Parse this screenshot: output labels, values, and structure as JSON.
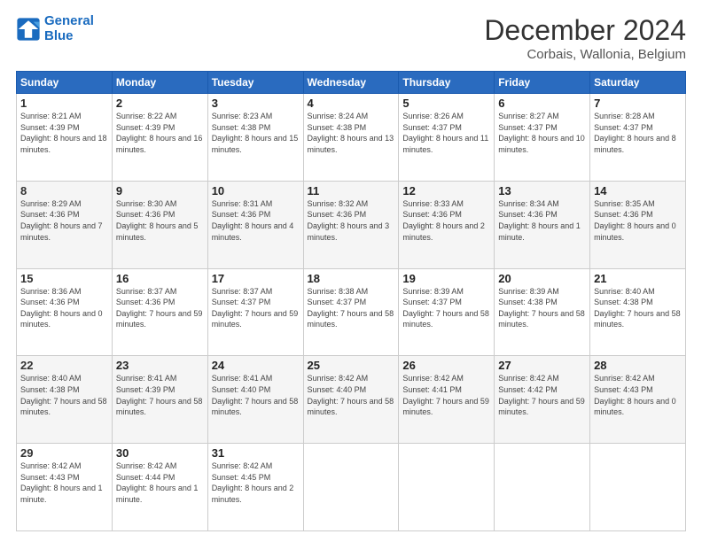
{
  "logo": {
    "line1": "General",
    "line2": "Blue"
  },
  "title": "December 2024",
  "subtitle": "Corbais, Wallonia, Belgium",
  "weekdays": [
    "Sunday",
    "Monday",
    "Tuesday",
    "Wednesday",
    "Thursday",
    "Friday",
    "Saturday"
  ],
  "weeks": [
    [
      {
        "day": "1",
        "sunrise": "8:21 AM",
        "sunset": "4:39 PM",
        "daylight": "8 hours and 18 minutes."
      },
      {
        "day": "2",
        "sunrise": "8:22 AM",
        "sunset": "4:39 PM",
        "daylight": "8 hours and 16 minutes."
      },
      {
        "day": "3",
        "sunrise": "8:23 AM",
        "sunset": "4:38 PM",
        "daylight": "8 hours and 15 minutes."
      },
      {
        "day": "4",
        "sunrise": "8:24 AM",
        "sunset": "4:38 PM",
        "daylight": "8 hours and 13 minutes."
      },
      {
        "day": "5",
        "sunrise": "8:26 AM",
        "sunset": "4:37 PM",
        "daylight": "8 hours and 11 minutes."
      },
      {
        "day": "6",
        "sunrise": "8:27 AM",
        "sunset": "4:37 PM",
        "daylight": "8 hours and 10 minutes."
      },
      {
        "day": "7",
        "sunrise": "8:28 AM",
        "sunset": "4:37 PM",
        "daylight": "8 hours and 8 minutes."
      }
    ],
    [
      {
        "day": "8",
        "sunrise": "8:29 AM",
        "sunset": "4:36 PM",
        "daylight": "8 hours and 7 minutes."
      },
      {
        "day": "9",
        "sunrise": "8:30 AM",
        "sunset": "4:36 PM",
        "daylight": "8 hours and 5 minutes."
      },
      {
        "day": "10",
        "sunrise": "8:31 AM",
        "sunset": "4:36 PM",
        "daylight": "8 hours and 4 minutes."
      },
      {
        "day": "11",
        "sunrise": "8:32 AM",
        "sunset": "4:36 PM",
        "daylight": "8 hours and 3 minutes."
      },
      {
        "day": "12",
        "sunrise": "8:33 AM",
        "sunset": "4:36 PM",
        "daylight": "8 hours and 2 minutes."
      },
      {
        "day": "13",
        "sunrise": "8:34 AM",
        "sunset": "4:36 PM",
        "daylight": "8 hours and 1 minute."
      },
      {
        "day": "14",
        "sunrise": "8:35 AM",
        "sunset": "4:36 PM",
        "daylight": "8 hours and 0 minutes."
      }
    ],
    [
      {
        "day": "15",
        "sunrise": "8:36 AM",
        "sunset": "4:36 PM",
        "daylight": "8 hours and 0 minutes."
      },
      {
        "day": "16",
        "sunrise": "8:37 AM",
        "sunset": "4:36 PM",
        "daylight": "7 hours and 59 minutes."
      },
      {
        "day": "17",
        "sunrise": "8:37 AM",
        "sunset": "4:37 PM",
        "daylight": "7 hours and 59 minutes."
      },
      {
        "day": "18",
        "sunrise": "8:38 AM",
        "sunset": "4:37 PM",
        "daylight": "7 hours and 58 minutes."
      },
      {
        "day": "19",
        "sunrise": "8:39 AM",
        "sunset": "4:37 PM",
        "daylight": "7 hours and 58 minutes."
      },
      {
        "day": "20",
        "sunrise": "8:39 AM",
        "sunset": "4:38 PM",
        "daylight": "7 hours and 58 minutes."
      },
      {
        "day": "21",
        "sunrise": "8:40 AM",
        "sunset": "4:38 PM",
        "daylight": "7 hours and 58 minutes."
      }
    ],
    [
      {
        "day": "22",
        "sunrise": "8:40 AM",
        "sunset": "4:38 PM",
        "daylight": "7 hours and 58 minutes."
      },
      {
        "day": "23",
        "sunrise": "8:41 AM",
        "sunset": "4:39 PM",
        "daylight": "7 hours and 58 minutes."
      },
      {
        "day": "24",
        "sunrise": "8:41 AM",
        "sunset": "4:40 PM",
        "daylight": "7 hours and 58 minutes."
      },
      {
        "day": "25",
        "sunrise": "8:42 AM",
        "sunset": "4:40 PM",
        "daylight": "7 hours and 58 minutes."
      },
      {
        "day": "26",
        "sunrise": "8:42 AM",
        "sunset": "4:41 PM",
        "daylight": "7 hours and 59 minutes."
      },
      {
        "day": "27",
        "sunrise": "8:42 AM",
        "sunset": "4:42 PM",
        "daylight": "7 hours and 59 minutes."
      },
      {
        "day": "28",
        "sunrise": "8:42 AM",
        "sunset": "4:43 PM",
        "daylight": "8 hours and 0 minutes."
      }
    ],
    [
      {
        "day": "29",
        "sunrise": "8:42 AM",
        "sunset": "4:43 PM",
        "daylight": "8 hours and 1 minute."
      },
      {
        "day": "30",
        "sunrise": "8:42 AM",
        "sunset": "4:44 PM",
        "daylight": "8 hours and 1 minute."
      },
      {
        "day": "31",
        "sunrise": "8:42 AM",
        "sunset": "4:45 PM",
        "daylight": "8 hours and 2 minutes."
      },
      null,
      null,
      null,
      null
    ]
  ]
}
